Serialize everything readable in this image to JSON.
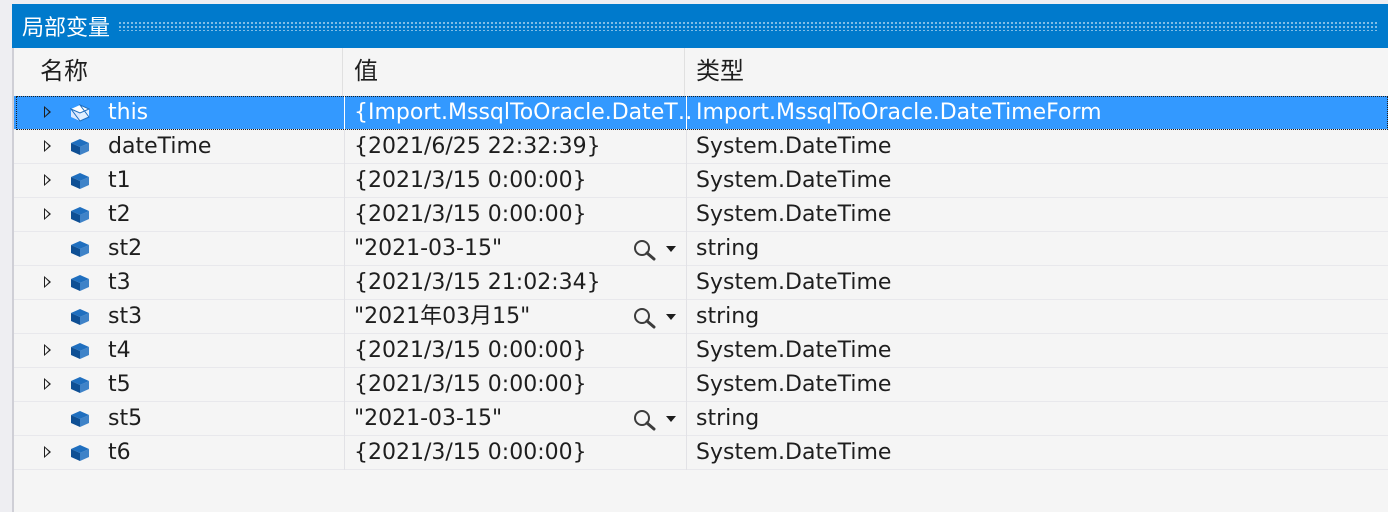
{
  "window": {
    "title": "局部变量"
  },
  "columns": {
    "name": "名称",
    "value": "值",
    "type": "类型"
  },
  "rows": [
    {
      "name": "this",
      "value": "{Import.MssqlToOracle.DateT…",
      "type": "Import.MssqlToOracle.DateTimeForm",
      "expandable": true,
      "selected": true,
      "visualizer": false
    },
    {
      "name": "dateTime",
      "value": "{2021/6/25 22:32:39}",
      "type": "System.DateTime",
      "expandable": true,
      "selected": false,
      "visualizer": false
    },
    {
      "name": "t1",
      "value": "{2021/3/15 0:00:00}",
      "type": "System.DateTime",
      "expandable": true,
      "selected": false,
      "visualizer": false
    },
    {
      "name": "t2",
      "value": "{2021/3/15 0:00:00}",
      "type": "System.DateTime",
      "expandable": true,
      "selected": false,
      "visualizer": false
    },
    {
      "name": "st2",
      "value": "\"2021-03-15\"",
      "type": "string",
      "expandable": false,
      "selected": false,
      "visualizer": true
    },
    {
      "name": "t3",
      "value": "{2021/3/15 21:02:34}",
      "type": "System.DateTime",
      "expandable": true,
      "selected": false,
      "visualizer": false
    },
    {
      "name": "st3",
      "value": "\"2021年03月15\"",
      "type": "string",
      "expandable": false,
      "selected": false,
      "visualizer": true
    },
    {
      "name": "t4",
      "value": "{2021/3/15 0:00:00}",
      "type": "System.DateTime",
      "expandable": true,
      "selected": false,
      "visualizer": false
    },
    {
      "name": "t5",
      "value": "{2021/3/15 0:00:00}",
      "type": "System.DateTime",
      "expandable": true,
      "selected": false,
      "visualizer": false
    },
    {
      "name": "st5",
      "value": "\"2021-03-15\"",
      "type": "string",
      "expandable": false,
      "selected": false,
      "visualizer": true
    },
    {
      "name": "t6",
      "value": "{2021/3/15 0:00:00}",
      "type": "System.DateTime",
      "expandable": true,
      "selected": false,
      "visualizer": false
    }
  ],
  "icons": {
    "field": "field-cube-icon",
    "expander": "expand-arrow-icon",
    "visualizer": "magnifier-icon",
    "visualizer_dropdown": "chevron-down-icon"
  },
  "colors": {
    "title_bar": "#007acc",
    "selection": "#3399ff",
    "field_icon": "#1f6fbf"
  }
}
